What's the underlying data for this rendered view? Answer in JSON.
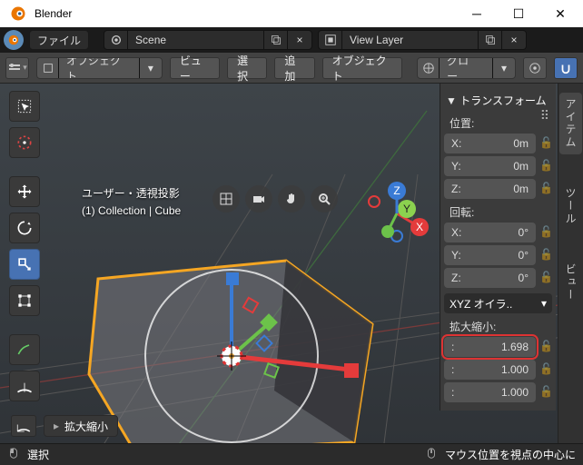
{
  "window": {
    "title": "Blender"
  },
  "topbar": {
    "file": "ファイル",
    "scene_label": "Scene",
    "viewlayer_label": "View Layer"
  },
  "header": {
    "mode": "オブジェクト..",
    "menu_view": "ビュー",
    "menu_select": "選択",
    "menu_add": "追加",
    "menu_object": "オブジェクト",
    "orientation": "グロー..."
  },
  "overlay": {
    "line1": "ユーザー・透視投影",
    "line2": "(1) Collection | Cube"
  },
  "npanel": {
    "title": "トランスフォーム",
    "loc_label": "位置:",
    "rot_label": "回転:",
    "scale_label": "拡大縮小:",
    "loc": {
      "x_l": "X:",
      "x_v": "0m",
      "y_l": "Y:",
      "y_v": "0m",
      "z_l": "Z:",
      "z_v": "0m"
    },
    "rot": {
      "x_l": "X:",
      "x_v": "0°",
      "y_l": "Y:",
      "y_v": "0°",
      "z_l": "Z:",
      "z_v": "0°"
    },
    "rot_mode": "XYZ オイラ..",
    "scale": {
      "x_l": ":",
      "x_v": "1.698",
      "y_l": ":",
      "y_v": "1.000",
      "z_l": ":",
      "z_v": "1.000"
    }
  },
  "side_tabs": {
    "item": "アイテム",
    "tool": "ツール",
    "view": "ビュー"
  },
  "bottom": {
    "redo_panel": "拡大縮小"
  },
  "status": {
    "left": "選択",
    "right": "マウス位置を視点の中心に"
  },
  "axis": {
    "x": "X",
    "y": "Y",
    "z": "Z"
  }
}
